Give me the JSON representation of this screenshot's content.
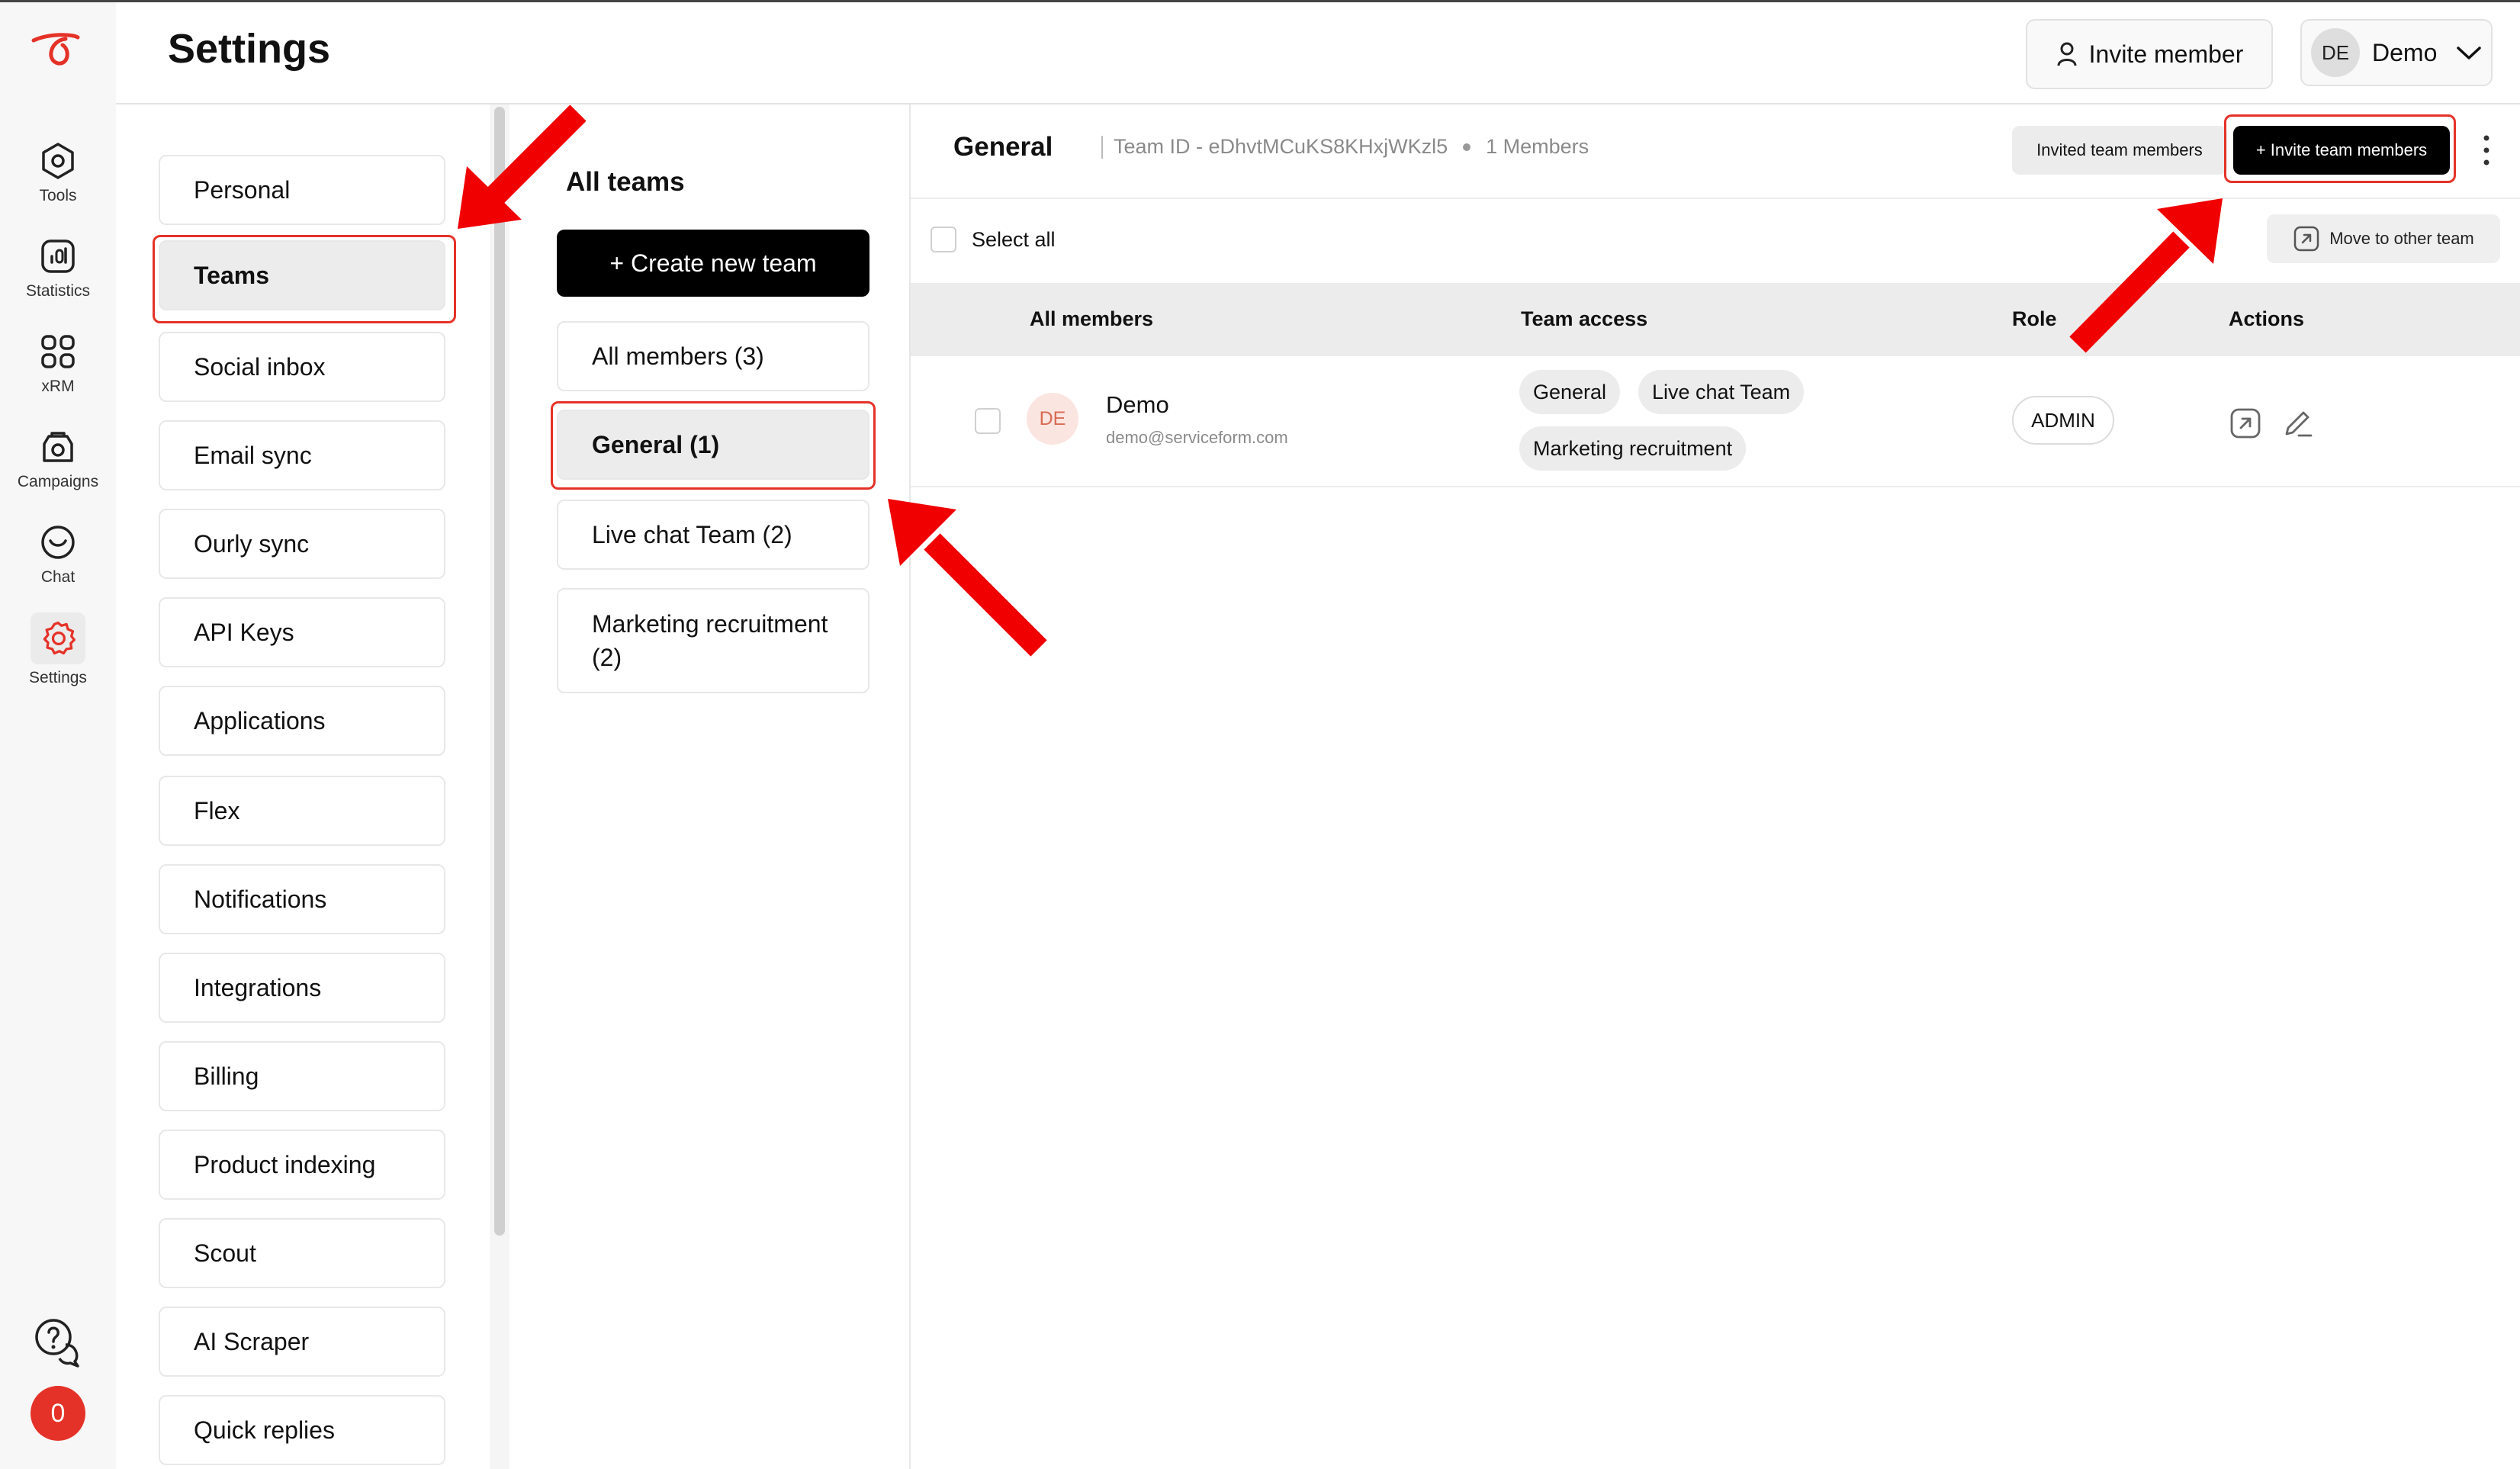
{
  "header": {
    "title": "Settings",
    "invite_member": "Invite member",
    "user_initials": "DE",
    "user_name": "Demo"
  },
  "rail": {
    "items": [
      {
        "label": "Tools",
        "icon": "hexagon-icon"
      },
      {
        "label": "Statistics",
        "icon": "bar-chart-icon"
      },
      {
        "label": "xRM",
        "icon": "grid-icon"
      },
      {
        "label": "Campaigns",
        "icon": "campaign-icon"
      },
      {
        "label": "Chat",
        "icon": "chat-icon"
      },
      {
        "label": "Settings",
        "icon": "gear-icon"
      }
    ],
    "notification_count": "0"
  },
  "menu": {
    "items": [
      "Personal",
      "Teams",
      "Social inbox",
      "Email sync",
      "Ourly sync",
      "API Keys",
      "Applications",
      "Flex",
      "Notifications",
      "Integrations",
      "Billing",
      "Product indexing",
      "Scout",
      "AI Scraper",
      "Quick replies"
    ],
    "active": "Teams"
  },
  "teams": {
    "title": "All teams",
    "create_label": "+ Create new team",
    "items": [
      "All members (3)",
      "General (1)",
      "Live chat Team (2)",
      "Marketing recruitment (2)"
    ],
    "active": "General (1)"
  },
  "main": {
    "title": "General",
    "team_id": "Team ID - eDhvtMCuKS8KHxjWKzl5",
    "member_count": "1 Members",
    "invited_label": "Invited team members",
    "invite_label": "+ Invite team members",
    "select_all": "Select all",
    "move_label": "Move to other team",
    "columns": {
      "members": "All members",
      "access": "Team access",
      "role": "Role",
      "actions": "Actions"
    },
    "rows": [
      {
        "initials": "DE",
        "name": "Demo",
        "email": "demo@serviceform.com",
        "access": [
          "General",
          "Live chat Team",
          "Marketing recruitment"
        ],
        "role": "ADMIN"
      }
    ]
  },
  "colors": {
    "accent": "#e53228",
    "primary_button": "#000000",
    "active_bg": "#ececec"
  }
}
